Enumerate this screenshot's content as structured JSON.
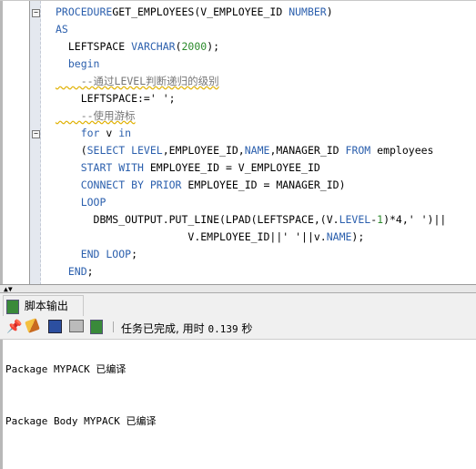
{
  "editor": {
    "lines": [
      {
        "parts": [
          [
            "kw",
            "PROCEDURE"
          ],
          [
            "",
            "GET_EMPLOYEES(V_EMPLOYEE_ID "
          ],
          [
            "kw",
            "NUMBER"
          ],
          [
            "",
            ")"
          ]
        ]
      },
      {
        "parts": [
          [
            "kw",
            "AS"
          ]
        ]
      },
      {
        "parts": [
          [
            "",
            "  LEFTSPACE "
          ],
          [
            "kw",
            "VARCHAR"
          ],
          [
            "",
            "("
          ],
          [
            "num",
            "2000"
          ],
          [
            "",
            ");"
          ]
        ]
      },
      {
        "parts": [
          [
            "kw",
            "  begin"
          ]
        ]
      },
      {
        "parts": [
          [
            "cm",
            "    --通过LEVEL判断递归的级别"
          ]
        ]
      },
      {
        "parts": [
          [
            "",
            "    LEFTSPACE:=' ';"
          ]
        ]
      },
      {
        "parts": [
          [
            "cm",
            "    --使用游标"
          ]
        ]
      },
      {
        "parts": [
          [
            "kw",
            "    for"
          ],
          [
            "",
            " v "
          ],
          [
            "kw",
            "in"
          ]
        ]
      },
      {
        "parts": [
          [
            "",
            "    ("
          ],
          [
            "kw",
            "SELECT LEVEL"
          ],
          [
            "",
            ",EMPLOYEE_ID,"
          ],
          [
            "kw",
            "NAME"
          ],
          [
            "",
            ",MANAGER_ID "
          ],
          [
            "kw",
            "FROM"
          ],
          [
            "",
            " employees"
          ]
        ]
      },
      {
        "parts": [
          [
            "kw",
            "    START WITH"
          ],
          [
            "",
            " EMPLOYEE_ID = V_EMPLOYEE_ID"
          ]
        ]
      },
      {
        "parts": [
          [
            "kw",
            "    CONNECT BY PRIOR"
          ],
          [
            "",
            " EMPLOYEE_ID = MANAGER_ID)"
          ]
        ]
      },
      {
        "parts": [
          [
            "kw",
            "    LOOP"
          ]
        ]
      },
      {
        "parts": [
          [
            "",
            "      DBMS_OUTPUT.PUT_LINE(LPAD(LEFTSPACE,(V."
          ],
          [
            "kw",
            "LEVEL"
          ],
          [
            "",
            "-"
          ],
          [
            "num",
            "1"
          ],
          [
            "",
            ")*4,' ')||"
          ]
        ]
      },
      {
        "parts": [
          [
            "",
            "                     V.EMPLOYEE_ID||' '||v."
          ],
          [
            "kw",
            "NAME"
          ],
          [
            "",
            ");"
          ]
        ]
      },
      {
        "parts": [
          [
            "kw",
            "    END LOOP"
          ],
          [
            "",
            ";"
          ]
        ]
      },
      {
        "parts": [
          [
            "kw",
            "  END"
          ],
          [
            "",
            ";"
          ]
        ]
      }
    ],
    "fold_lines": [
      0,
      7
    ]
  },
  "output_panel": {
    "tab_label": "脚本输出",
    "close": "x",
    "status": "任务已完成, 用时",
    "time": "0.139",
    "unit": "秒",
    "icons": [
      "pin-icon",
      "eraser-icon",
      "save-icon",
      "print-icon",
      "script-output-icon"
    ],
    "lines": [
      "Package MYPACK 已编译",
      "Package Body MYPACK 已编译"
    ]
  }
}
